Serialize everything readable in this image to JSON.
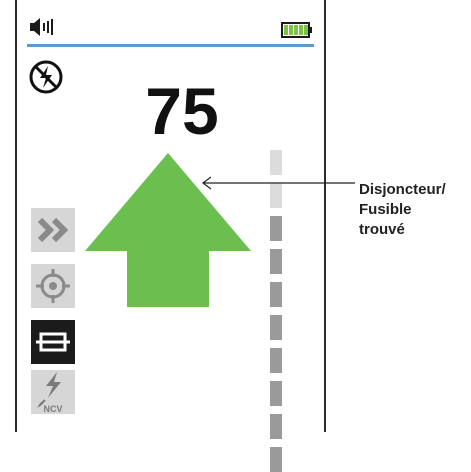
{
  "display": {
    "reading": "75",
    "battery_level": 1.0
  },
  "modes": [
    {
      "name": "fast-forward",
      "active": false
    },
    {
      "name": "target-locate",
      "active": false
    },
    {
      "name": "fuse",
      "active": true
    },
    {
      "name": "ncv",
      "active": false,
      "label": "NCV"
    }
  ],
  "signal_gauge": {
    "segments_total": 10,
    "lit_from_bottom": 8
  },
  "callout": {
    "line1": "Disjoncteur/",
    "line2": "Fusible",
    "line3": "trouvé"
  },
  "colors": {
    "arrow": "#6bbf4f",
    "status_line": "#5b9bd5",
    "battery": "#7dc242",
    "gauge_lit": "#9a9a9a",
    "gauge_dim": "#dcdcdc",
    "mode_active_bg": "#1b1b1b",
    "mode_inactive_bg": "#d6d6d6"
  },
  "icons": {
    "speaker": "speaker-icon",
    "battery": "battery-icon",
    "no_voltage": "no-voltage-icon",
    "arrow": "up-arrow-icon",
    "fast_forward": "double-chevron-right-icon",
    "target": "crosshair-icon",
    "fuse": "fuse-icon",
    "ncv": "ncv-icon"
  }
}
